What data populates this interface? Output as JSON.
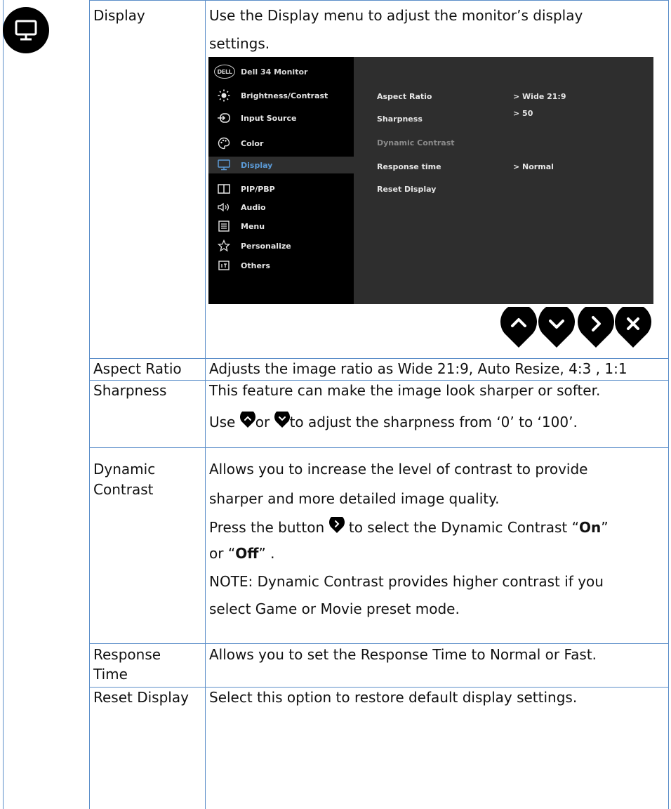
{
  "display_icon": "monitor-icon",
  "section": {
    "label": "Display",
    "desc_line1": "Use the Display menu to adjust the monitor’s display",
    "desc_line2": "settings."
  },
  "osd": {
    "title": "Dell 34 Monitor",
    "menu": [
      {
        "label": "Brightness/Contrast",
        "icon": "brightness-icon",
        "active": false
      },
      {
        "label": "Input Source",
        "icon": "input-source-icon",
        "active": false
      },
      {
        "label": "Color",
        "icon": "palette-icon",
        "active": false
      },
      {
        "label": "Display",
        "icon": "monitor-icon",
        "active": true
      },
      {
        "label": "PIP/PBP",
        "icon": "pip-icon",
        "active": false
      },
      {
        "label": "Audio",
        "icon": "speaker-icon",
        "active": false
      },
      {
        "label": "Menu",
        "icon": "menu-icon",
        "active": false
      },
      {
        "label": "Personalize",
        "icon": "star-icon",
        "active": false
      },
      {
        "label": "Others",
        "icon": "others-icon",
        "active": false
      }
    ],
    "settings": [
      {
        "label": "Aspect Ratio",
        "value": "> Wide 21:9"
      },
      {
        "label": "Sharpness",
        "value": "> 50"
      },
      {
        "label": "Dynamic Contrast",
        "value": ""
      },
      {
        "label": "Response time",
        "value": "> Normal"
      },
      {
        "label": "Reset Display",
        "value": ""
      }
    ],
    "colors": {
      "active_text": "#5b9ad6",
      "panel_bg": "#000000",
      "content_bg": "#2e2e2e"
    }
  },
  "nav_buttons": [
    "chevron-up-icon",
    "chevron-down-icon",
    "chevron-right-icon",
    "close-icon"
  ],
  "rows": {
    "aspect": {
      "label": "Aspect Ratio",
      "desc": "Adjusts the image ratio as Wide 21:9, Auto Resize, 4:3 , 1:1"
    },
    "sharpness": {
      "label": "Sharpness",
      "line1": "This feature can make the image look sharper or softer.",
      "line2_a": "Use ",
      "line2_b": "or ",
      "line2_c": "to adjust the sharpness from ‘0’ to ‘100’."
    },
    "dynamic": {
      "label_1": "Dynamic",
      "label_2": "Contrast",
      "line1": "Allows you to increase the level of contrast to provide",
      "line2": "sharper and more detailed image quality.",
      "line3_a": "Press the button ",
      "line3_b": " to select the Dynamic Contrast “",
      "line3_on": "On",
      "line3_c": "”",
      "line4_a": "or “",
      "line4_off": "Off",
      "line4_b": "” .",
      "note_label": "NOTE:",
      "note_text": " Dynamic Contrast provides higher contrast if you",
      "note_line2": "select Game or Movie preset mode."
    },
    "response": {
      "label_1": "Response",
      "label_2": "Time",
      "desc": "Allows you to set the Response Time to Normal or Fast."
    },
    "reset": {
      "label": "Reset Display",
      "desc": "Select this option to restore default display settings."
    }
  }
}
